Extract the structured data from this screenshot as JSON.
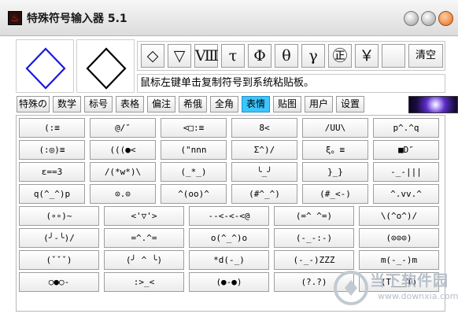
{
  "window": {
    "title": "特殊符号输入器 5.1",
    "app_icon_glyph": "♨"
  },
  "preview": {
    "left_color": "#1a1adf",
    "right_color": "#000000"
  },
  "toolbar": {
    "symbols": [
      "◇",
      "▽",
      "Ⅷ",
      "τ",
      "Φ",
      "θ",
      "γ",
      "㊣",
      "￥",
      ""
    ],
    "clear_label": "清空"
  },
  "hint": "鼠标左键单击复制符号到系统粘贴板。",
  "tabs": {
    "items": [
      "特殊の",
      "数学",
      "标号",
      "表格",
      "偏注",
      "希俄",
      "全角",
      "表情",
      "贴图",
      "用户",
      "设置"
    ],
    "active": "表情"
  },
  "grid": {
    "rows6": [
      [
        "(:≡",
        "@/″",
        "<□:≡",
        "8<",
        "/UU\\",
        "p^.^q"
      ],
      [
        "(:◎)≡",
        "(((●<",
        "(\"nnn",
        "Σ^)/",
        "ξ。≡",
        "■D″"
      ],
      [
        "ε==3",
        "/(*w*)\\",
        "(_*_)",
        "╰_╯",
        "}_}",
        "-_-|||"
      ],
      [
        "q(^_^)p",
        "⊙.⊙",
        "^(oo)^",
        "(#^_^)",
        "(#_<-)",
        "^.vv.^"
      ]
    ],
    "rows5": [
      [
        "(∘∘)~",
        "<'▽'>",
        "--<-<-<@",
        "(=^ ^=)",
        "\\(^o^)/"
      ],
      [
        "(╯-╰)/",
        "=^.^=",
        "o(^_^)o",
        "(-_-:-)",
        "(⊙⊙⊙)"
      ],
      [
        "(ˇˇˇ)",
        "(╯ ^ ╰)",
        "*d(-_)",
        "(-_-)ZZZ",
        "m(-_-)m"
      ]
    ],
    "rows4": [
      [
        "○●○-",
        ":>_<",
        "(●-●)",
        "(?.?)",
        "(T___T)"
      ]
    ]
  },
  "watermark": {
    "title": "当下软件园",
    "url": "www.downxia.com"
  }
}
